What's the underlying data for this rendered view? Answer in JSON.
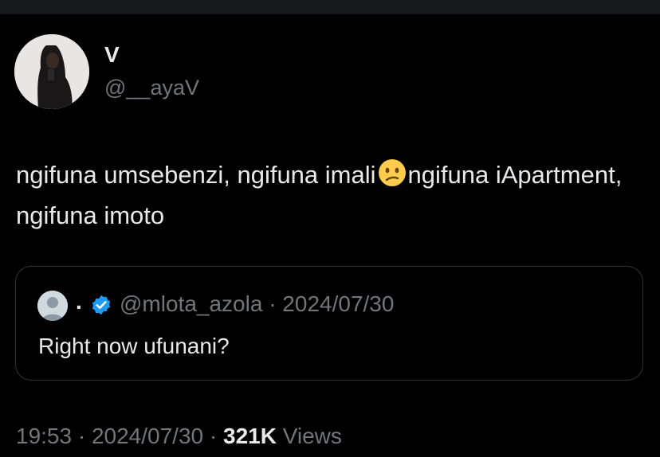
{
  "tweet": {
    "author_name": "V",
    "author_handle": "@__ayaV",
    "text_part1": "ngifuna umsebenzi, ngifuna imali",
    "emoji": "confused-face-emoji",
    "text_part2": "ngifuna iApartment, ngifuna imoto"
  },
  "quote": {
    "author_name": ".",
    "author_handle": "@mlota_azola",
    "separator": "·",
    "date": "2024/07/30",
    "text": "Right now ufunani?"
  },
  "footer": {
    "time": "19:53",
    "date": "2024/07/30",
    "sep": "·",
    "views_count": "321K",
    "views_label": "Views"
  }
}
